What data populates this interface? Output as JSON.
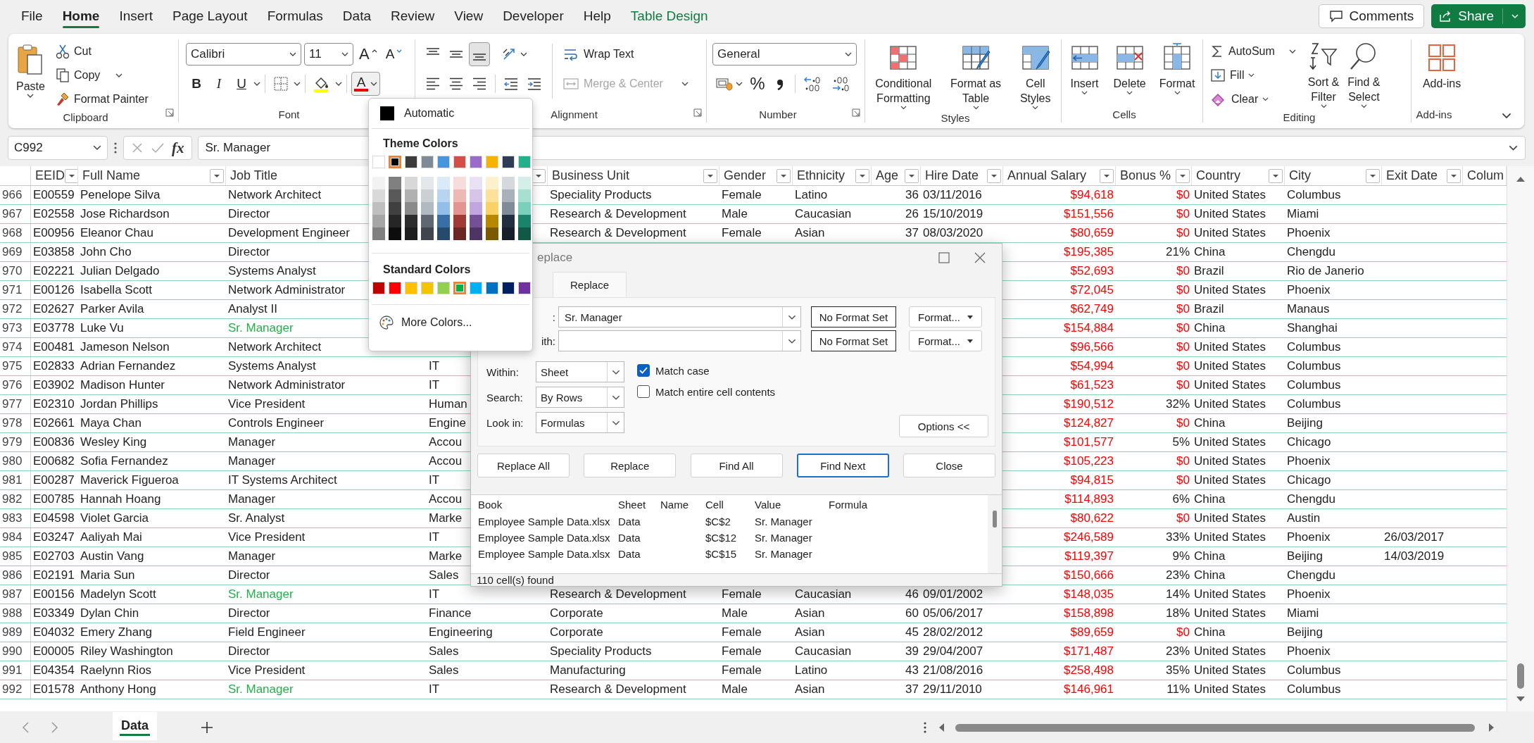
{
  "menu_tabs": [
    {
      "label": "File",
      "selected": false,
      "contextual": false
    },
    {
      "label": "Home",
      "selected": true,
      "contextual": false
    },
    {
      "label": "Insert",
      "selected": false,
      "contextual": false
    },
    {
      "label": "Page Layout",
      "selected": false,
      "contextual": false
    },
    {
      "label": "Formulas",
      "selected": false,
      "contextual": false
    },
    {
      "label": "Data",
      "selected": false,
      "contextual": false
    },
    {
      "label": "Review",
      "selected": false,
      "contextual": false
    },
    {
      "label": "View",
      "selected": false,
      "contextual": false
    },
    {
      "label": "Developer",
      "selected": false,
      "contextual": false
    },
    {
      "label": "Help",
      "selected": false,
      "contextual": false
    },
    {
      "label": "Table Design",
      "selected": false,
      "contextual": true
    }
  ],
  "header_buttons": {
    "comments": "Comments",
    "share": "Share"
  },
  "ribbon": {
    "clipboard": {
      "label": "Clipboard",
      "paste": "Paste",
      "cut": "Cut",
      "copy": "Copy",
      "format_painter": "Format Painter"
    },
    "font": {
      "label": "Font",
      "font_name": "Calibri",
      "font_size": "11",
      "grow": "A",
      "shrink": "A",
      "bold": "B",
      "italic": "I",
      "underline": "U",
      "font_color": "A"
    },
    "alignment": {
      "label": "Alignment",
      "vertical_align": [
        {
          "selected": false
        },
        {
          "selected": false
        },
        {
          "selected": true
        }
      ],
      "wrap_text": "Wrap Text",
      "merge_center": {
        "label": "Merge & Center",
        "disabled": true
      }
    },
    "number": {
      "label": "Number",
      "format": "General",
      "percent": "%"
    },
    "styles": {
      "label": "Styles",
      "buttons": [
        "Conditional\nFormatting",
        "Format as\nTable",
        "Cell\nStyles"
      ]
    },
    "cells": {
      "label": "Cells",
      "buttons": [
        "Insert",
        "Delete",
        "Format"
      ]
    },
    "editing": {
      "label": "Editing",
      "autosum": "AutoSum",
      "fill": "Fill",
      "clear": "Clear",
      "sort_filter": "Sort &\nFilter",
      "find_select": "Find &\nSelect"
    },
    "addins": {
      "label": "Add-ins",
      "button": "Add-ins"
    }
  },
  "formula_bar": {
    "name_box": "C992",
    "fx": "fx",
    "formula": "Sr. Manager"
  },
  "sheet": {
    "columns": [
      "EEID",
      "Full Name",
      "Job Title",
      null,
      "Business Unit",
      "Gender",
      "Ethnicity",
      "Age",
      "Hire Date",
      "Annual Salary",
      "Bonus %",
      "Country",
      "City",
      "Exit Date",
      "Colum"
    ],
    "rows": [
      {
        "number": "966",
        "found": false,
        "bonus_red": true,
        "cells": [
          "E00559",
          "Penelope Silva",
          "Network Architect",
          null,
          "Speciality Products",
          "Female",
          "Latino",
          "36",
          "03/11/2016",
          "$94,618",
          "$0",
          "United States",
          "Columbus",
          null,
          null
        ]
      },
      {
        "number": "967",
        "found": false,
        "bonus_red": true,
        "cells": [
          "E02558",
          "Jose Richardson",
          "Director",
          null,
          "Research & Development",
          "Male",
          "Caucasian",
          "26",
          "15/10/2019",
          "$151,556",
          "$0",
          "United States",
          "Miami",
          null,
          null
        ]
      },
      {
        "number": "968",
        "found": false,
        "bonus_red": true,
        "cells": [
          "E00956",
          "Eleanor Chau",
          "Development Engineer",
          null,
          "Research & Development",
          "Female",
          "Asian",
          "37",
          "08/03/2020",
          "$80,659",
          "$0",
          "United States",
          "Phoenix",
          null,
          null
        ]
      },
      {
        "number": "969",
        "found": false,
        "bonus_red": false,
        "cells": [
          "E03858",
          "John Cho",
          "Director",
          null,
          null,
          null,
          null,
          null,
          null,
          "$195,385",
          "21%",
          "China",
          "Chengdu",
          null,
          null
        ]
      },
      {
        "number": "970",
        "found": false,
        "bonus_red": true,
        "cells": [
          "E02221",
          "Julian Delgado",
          "Systems Analyst",
          null,
          null,
          null,
          null,
          null,
          null,
          "$52,693",
          "$0",
          "Brazil",
          "Rio de Janerio",
          null,
          null
        ]
      },
      {
        "number": "971",
        "found": false,
        "bonus_red": true,
        "cells": [
          "E00126",
          "Isabella Scott",
          "Network Administrator",
          null,
          null,
          null,
          null,
          null,
          null,
          "$72,045",
          "$0",
          "United States",
          "Phoenix",
          null,
          null
        ]
      },
      {
        "number": "972",
        "found": false,
        "bonus_red": true,
        "cells": [
          "E02627",
          "Parker Avila",
          "Analyst II",
          null,
          null,
          null,
          null,
          null,
          null,
          "$62,749",
          "$0",
          "Brazil",
          "Manaus",
          null,
          null
        ]
      },
      {
        "number": "973",
        "found": true,
        "bonus_red": true,
        "cells": [
          "E03778",
          "Luke Vu",
          "Sr. Manager",
          null,
          null,
          null,
          null,
          null,
          null,
          "$154,884",
          "$0",
          "China",
          "Shanghai",
          null,
          null
        ]
      },
      {
        "number": "974",
        "found": false,
        "bonus_red": true,
        "cells": [
          "E00481",
          "Jameson Nelson",
          "Network Architect",
          null,
          null,
          null,
          null,
          null,
          null,
          "$96,566",
          "$0",
          "United States",
          "Columbus",
          null,
          null
        ]
      },
      {
        "number": "975",
        "found": false,
        "bonus_red": true,
        "cells": [
          "E02833",
          "Adrian Fernandez",
          "Systems Analyst",
          "IT",
          null,
          null,
          null,
          null,
          null,
          "$54,994",
          "$0",
          "United States",
          "Columbus",
          null,
          null
        ]
      },
      {
        "number": "976",
        "found": false,
        "bonus_red": true,
        "cells": [
          "E03902",
          "Madison Hunter",
          "Network Administrator",
          "IT",
          null,
          null,
          null,
          null,
          null,
          "$61,523",
          "$0",
          "United States",
          "Columbus",
          null,
          null
        ]
      },
      {
        "number": "977",
        "found": false,
        "bonus_red": false,
        "cells": [
          "E02310",
          "Jordan Phillips",
          "Vice President",
          "Human",
          null,
          null,
          null,
          null,
          null,
          "$190,512",
          "32%",
          "United States",
          "Columbus",
          null,
          null
        ]
      },
      {
        "number": "978",
        "found": false,
        "bonus_red": true,
        "cells": [
          "E02661",
          "Maya Chan",
          "Controls Engineer",
          "Engine",
          null,
          null,
          null,
          null,
          null,
          "$124,827",
          "$0",
          "China",
          "Beijing",
          null,
          null
        ]
      },
      {
        "number": "979",
        "found": false,
        "bonus_red": false,
        "cells": [
          "E00836",
          "Wesley King",
          "Manager",
          "Accou",
          null,
          null,
          null,
          null,
          null,
          "$101,577",
          "5%",
          "United States",
          "Chicago",
          null,
          null
        ]
      },
      {
        "number": "980",
        "found": false,
        "bonus_red": true,
        "cells": [
          "E00682",
          "Sofia Fernandez",
          "Manager",
          "Accou",
          null,
          null,
          null,
          null,
          null,
          "$105,223",
          "$0",
          "United States",
          "Phoenix",
          null,
          null
        ]
      },
      {
        "number": "981",
        "found": false,
        "bonus_red": true,
        "cells": [
          "E00287",
          "Maverick Figueroa",
          "IT Systems Architect",
          "IT",
          null,
          null,
          null,
          null,
          null,
          "$94,815",
          "$0",
          "United States",
          "Chicago",
          null,
          null
        ]
      },
      {
        "number": "982",
        "found": false,
        "bonus_red": false,
        "cells": [
          "E00785",
          "Hannah Hoang",
          "Manager",
          "Accou",
          null,
          null,
          null,
          null,
          null,
          "$114,893",
          "6%",
          "China",
          "Chengdu",
          null,
          null
        ]
      },
      {
        "number": "983",
        "found": false,
        "bonus_red": true,
        "cells": [
          "E04598",
          "Violet Garcia",
          "Sr. Analyst",
          "Marke",
          null,
          null,
          null,
          null,
          null,
          "$80,622",
          "$0",
          "United States",
          "Austin",
          null,
          null
        ]
      },
      {
        "number": "984",
        "found": false,
        "bonus_red": false,
        "cells": [
          "E03247",
          "Aaliyah Mai",
          "Vice President",
          "IT",
          null,
          null,
          null,
          null,
          null,
          "$246,589",
          "33%",
          "United States",
          "Phoenix",
          "26/03/2017",
          null
        ]
      },
      {
        "number": "985",
        "found": false,
        "bonus_red": false,
        "cells": [
          "E02703",
          "Austin Vang",
          "Manager",
          "Marke",
          null,
          null,
          null,
          null,
          null,
          "$119,397",
          "9%",
          "China",
          "Beijing",
          "14/03/2019",
          null
        ]
      },
      {
        "number": "986",
        "found": false,
        "bonus_red": false,
        "cells": [
          "E02191",
          "Maria Sun",
          "Director",
          "Sales",
          null,
          null,
          null,
          null,
          null,
          "$150,666",
          "23%",
          "China",
          "Chengdu",
          null,
          null
        ]
      },
      {
        "number": "987",
        "found": true,
        "bonus_red": false,
        "cells": [
          "E00156",
          "Madelyn Scott",
          "Sr. Manager",
          "IT",
          "Research & Development",
          "Female",
          "Caucasian",
          "46",
          "09/01/2002",
          "$148,035",
          "14%",
          "United States",
          "Phoenix",
          null,
          null
        ]
      },
      {
        "number": "988",
        "found": false,
        "bonus_red": false,
        "cells": [
          "E03349",
          "Dylan Chin",
          "Director",
          "Finance",
          "Corporate",
          "Male",
          "Asian",
          "60",
          "05/06/2017",
          "$158,898",
          "18%",
          "United States",
          "Miami",
          null,
          null
        ]
      },
      {
        "number": "989",
        "found": false,
        "bonus_red": true,
        "cells": [
          "E04032",
          "Emery Zhang",
          "Field Engineer",
          "Engineering",
          "Corporate",
          "Female",
          "Asian",
          "45",
          "28/02/2012",
          "$89,659",
          "$0",
          "China",
          "Beijing",
          null,
          null
        ]
      },
      {
        "number": "990",
        "found": false,
        "bonus_red": false,
        "cells": [
          "E00005",
          "Riley Washington",
          "Director",
          "Sales",
          "Speciality Products",
          "Female",
          "Caucasian",
          "39",
          "29/04/2007",
          "$171,487",
          "23%",
          "United States",
          "Phoenix",
          null,
          null
        ]
      },
      {
        "number": "991",
        "found": false,
        "bonus_red": false,
        "cells": [
          "E04354",
          "Raelynn Rios",
          "Vice President",
          "Sales",
          "Manufacturing",
          "Female",
          "Latino",
          "43",
          "21/08/2016",
          "$258,498",
          "35%",
          "United States",
          "Columbus",
          null,
          null
        ]
      },
      {
        "number": "992",
        "found": true,
        "bonus_red": false,
        "cells": [
          "E01578",
          "Anthony Hong",
          "Sr. Manager",
          "IT",
          "Research & Development",
          "Male",
          "Asian",
          "37",
          "29/11/2010",
          "$146,961",
          "11%",
          "United States",
          "Columbus",
          null,
          null
        ]
      }
    ]
  },
  "color_menu": {
    "automatic": "Automatic",
    "theme_title": "Theme Colors",
    "theme_colors": [
      {
        "color": "#ffffff",
        "selected": false
      },
      {
        "color": "#000000",
        "selected": true
      },
      {
        "color": "#3c3c3c",
        "selected": false
      },
      {
        "color": "#7e8a96",
        "selected": false
      },
      {
        "color": "#4a94dc",
        "selected": false
      },
      {
        "color": "#d44f47",
        "selected": false
      },
      {
        "color": "#9a6bc9",
        "selected": false
      },
      {
        "color": "#f4b400",
        "selected": false
      },
      {
        "color": "#2e3d55",
        "selected": false
      },
      {
        "color": "#22b08d",
        "selected": false
      }
    ],
    "standard_title": "Standard Colors",
    "standard_colors": [
      {
        "color": "#c00000",
        "selected": false
      },
      {
        "color": "#ff0000",
        "selected": false
      },
      {
        "color": "#ffc000",
        "selected": false
      },
      {
        "color": "#f5c400",
        "selected": false
      },
      {
        "color": "#92d050",
        "selected": false
      },
      {
        "color": "#00b050",
        "selected": true
      },
      {
        "color": "#00b0f0",
        "selected": false
      },
      {
        "color": "#0070c0",
        "selected": false
      },
      {
        "color": "#002060",
        "selected": false
      },
      {
        "color": "#7030a0",
        "selected": false
      }
    ],
    "more_colors": "More Colors..."
  },
  "replace_dialog": {
    "title": "eplace",
    "tabs": [
      {
        "label": "Replace",
        "selected": true
      }
    ],
    "find_label": ":",
    "find_value": "Sr. Manager",
    "replace_label": "ith:",
    "format_boxes": [
      "No Format Set",
      "No Format Set"
    ],
    "format_buttons": [
      "Format...",
      "Format..."
    ],
    "options": [
      {
        "label": "Within:",
        "value": "Sheet"
      },
      {
        "label": "Search:",
        "value": "By Rows"
      },
      {
        "label": "Look in:",
        "value": "Formulas"
      }
    ],
    "checks": [
      {
        "label": "Match case",
        "checked": true
      },
      {
        "label": "Match entire cell contents",
        "checked": false
      }
    ],
    "options_button": "Options <<",
    "buttons": [
      {
        "label": "Replace All",
        "focused": false
      },
      {
        "label": "Replace",
        "focused": false
      },
      {
        "label": "Find All",
        "focused": false
      },
      {
        "label": "Find Next",
        "focused": true
      },
      {
        "label": "Close",
        "focused": false
      }
    ],
    "results": {
      "columns": [
        "Book",
        "Sheet",
        "Name",
        "Cell",
        "Value",
        "Formula"
      ],
      "rows": [
        [
          "Employee Sample Data.xlsx",
          "Data",
          null,
          "$C$2",
          "Sr. Manager",
          null
        ],
        [
          "Employee Sample Data.xlsx",
          "Data",
          null,
          "$C$12",
          "Sr. Manager",
          null
        ],
        [
          "Employee Sample Data.xlsx",
          "Data",
          null,
          "$C$15",
          "Sr. Manager",
          null
        ]
      ]
    },
    "status": "110 cell(s) found"
  },
  "sheet_tabs": [
    {
      "label": "Data",
      "selected": true
    }
  ]
}
